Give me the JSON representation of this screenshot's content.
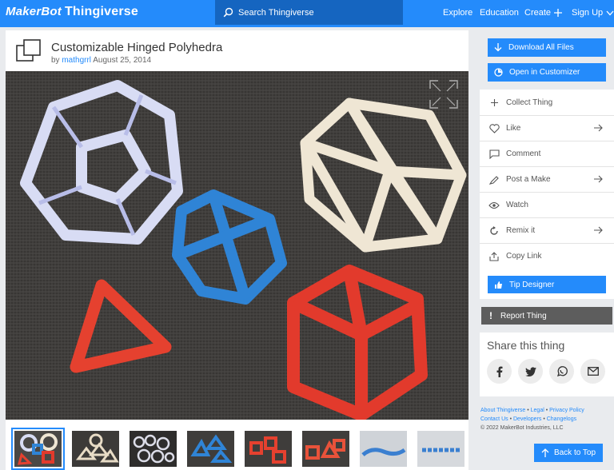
{
  "header": {
    "logo_prefix": "MakerBot",
    "logo_name": "Thingiverse",
    "search_placeholder": "Search Thingiverse",
    "nav": [
      "Explore",
      "Education",
      "Create",
      "Sign Up"
    ]
  },
  "thing": {
    "title": "Customizable Hinged Polyhedra",
    "by_label": "by",
    "author": "mathgrrl",
    "date": "August 25, 2014",
    "thumbnail_count": 8,
    "selected_thumbnail": 1
  },
  "sidebar": {
    "download_label": "Download All Files",
    "customizer_label": "Open in Customizer",
    "actions": [
      {
        "label": "Collect Thing",
        "icon": "plus-icon"
      },
      {
        "label": "Like",
        "icon": "heart-icon"
      },
      {
        "label": "Comment",
        "icon": "comment-icon"
      },
      {
        "label": "Post a Make",
        "icon": "post-make-icon"
      },
      {
        "label": "Watch",
        "icon": "eye-icon"
      },
      {
        "label": "Remix it",
        "icon": "remix-icon"
      },
      {
        "label": "Copy Link",
        "icon": "share-icon"
      }
    ],
    "tip_label": "Tip Designer",
    "report_label": "Report Thing",
    "share_title": "Share this thing",
    "social": [
      "facebook-icon",
      "twitter-icon",
      "whatsapp-icon",
      "email-icon"
    ]
  },
  "footer": {
    "about": "About Thingiverse",
    "legal": "Legal",
    "privacy": "Privacy Policy",
    "contact": "Contact Us",
    "developers": "Developers",
    "changelogs": "Changelogs",
    "copyright": "©  2022 MakerBot Industries, LLC"
  },
  "back_to_top": "Back to Top",
  "colors": {
    "brand": "#248bfb",
    "search_bg": "#1565c0",
    "report": "#5d5d5d"
  }
}
